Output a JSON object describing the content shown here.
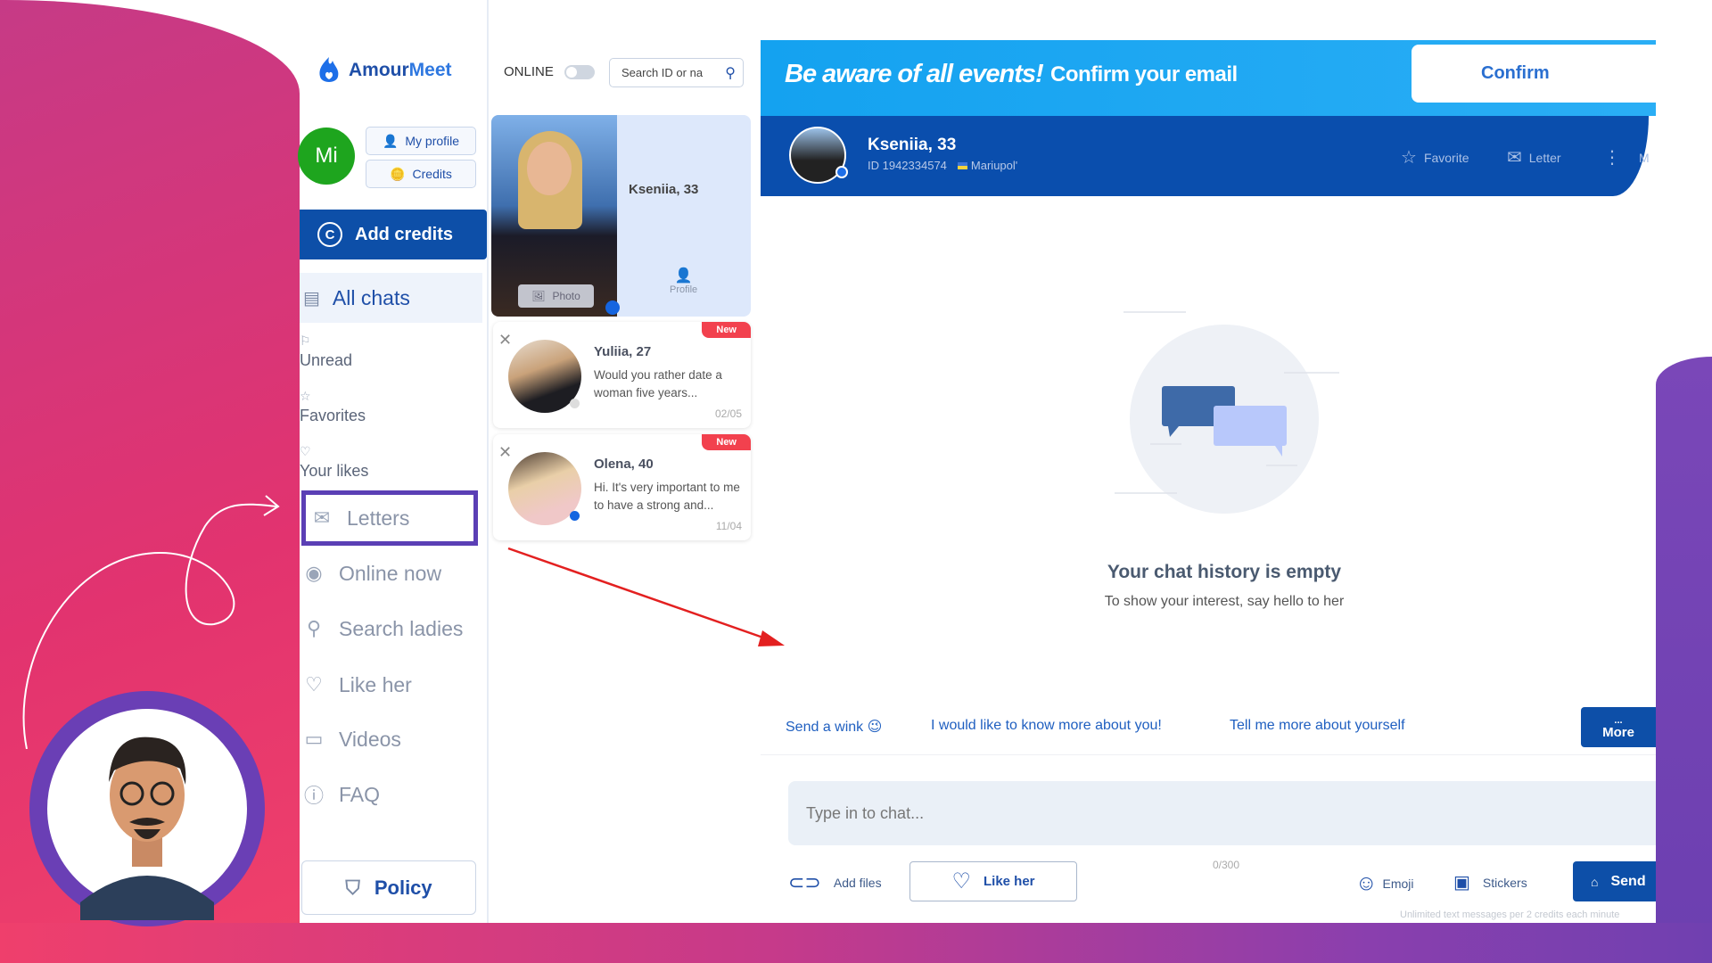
{
  "colors": {
    "brand": "#0d4fa8",
    "accent": "#1e6fe8",
    "badge": "#f2414e",
    "highlight": "#5b3fb5",
    "online": "#1ea51e"
  },
  "sidebar": {
    "logo": {
      "part1": "Amour",
      "part2": "Meet"
    },
    "avatar_initials": "Mi",
    "my_profile": "My profile",
    "credits": "Credits",
    "add_credits": "Add credits",
    "all_chats": "All chats",
    "sub_items": [
      {
        "label": "Unread",
        "icon": "flag-icon"
      },
      {
        "label": "Favorites",
        "icon": "star-icon"
      },
      {
        "label": "Your likes",
        "icon": "heart-icon"
      }
    ],
    "nav_items": [
      {
        "label": "Letters",
        "icon": "envelope-icon",
        "highlighted": true
      },
      {
        "label": "Online now",
        "icon": "eye-toggle-icon"
      },
      {
        "label": "Search ladies",
        "icon": "search-icon"
      },
      {
        "label": "Like her",
        "icon": "heart-icon"
      },
      {
        "label": "Videos",
        "icon": "video-icon"
      },
      {
        "label": "FAQ",
        "icon": "question-icon"
      }
    ],
    "policy": "Policy"
  },
  "chatlist": {
    "online_label": "ONLINE",
    "online_toggle": false,
    "search_placeholder": "Search ID or na",
    "featured": {
      "name": "Kseniia, 33",
      "photo_label": "Photo",
      "profile_label": "Profile"
    },
    "chats": [
      {
        "name": "Yuliia, 27",
        "message": "Would you rather date a woman five years...",
        "date": "02/05",
        "badge": "New",
        "online": false
      },
      {
        "name": "Olena, 40",
        "message": "Hi. It's very important to me to have a strong and...",
        "date": "11/04",
        "badge": "New",
        "online": true
      }
    ]
  },
  "banner": {
    "headline": "Be aware of all events!",
    "text": "Confirm your email",
    "button": "Confirm"
  },
  "header": {
    "name": "Kseniia, 33",
    "id": "ID 1942334574",
    "city": "Mariupol'",
    "favorite": "Favorite",
    "letter": "Letter",
    "more_cut": "M"
  },
  "empty": {
    "title": "Your chat history is empty",
    "subtitle": "To show your interest, say hello to her"
  },
  "quick_replies": [
    "Send a wink 😉",
    "I would like to know more about you!",
    "Tell me more about yourself"
  ],
  "more": {
    "dots": "...",
    "label": "More"
  },
  "composer": {
    "placeholder": "Type in to chat...",
    "counter": "0/300",
    "add_files": "Add files",
    "like_her": "Like her",
    "emoji": "Emoji",
    "stickers": "Stickers",
    "send": "Send",
    "footnote": "Unlimited text messages per 2 credits each minute"
  }
}
